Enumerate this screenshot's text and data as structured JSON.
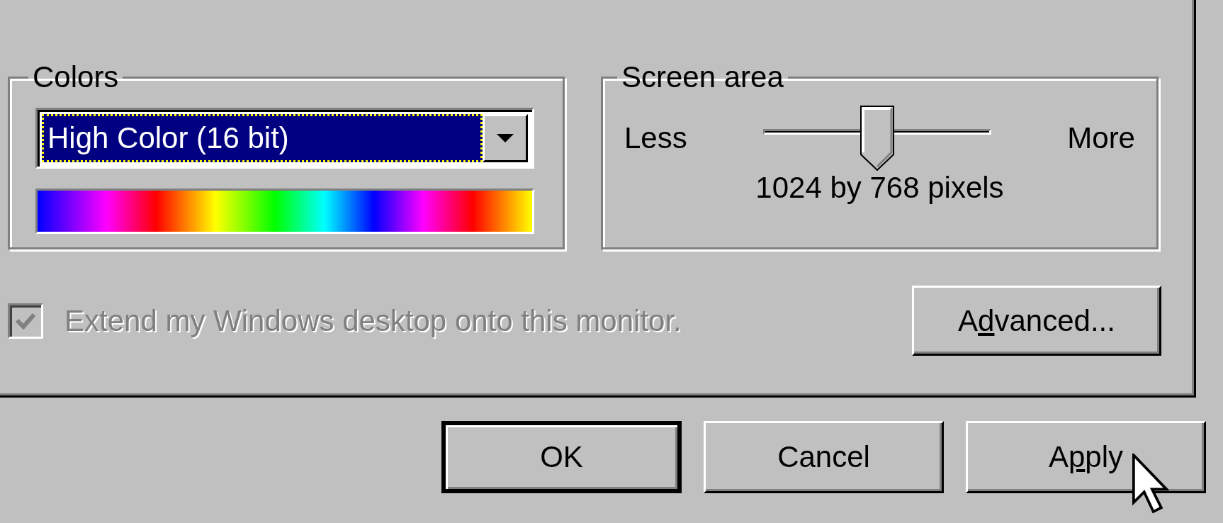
{
  "colors": {
    "label": "Colors",
    "value": "High Color (16 bit)",
    "focused": true
  },
  "screen_area": {
    "label": "Screen area",
    "min_label": "Less",
    "max_label": "More",
    "reading": "1024 by 768 pixels"
  },
  "extend_desktop": {
    "label": "Extend my Windows desktop onto this monitor.",
    "checked": true,
    "disabled": true
  },
  "advanced_button": {
    "before": "A",
    "access_key": "d",
    "after": "vanced..."
  },
  "buttons": [
    {
      "before": "OK",
      "default": true
    },
    {
      "before": "Cancel",
      "default": false
    },
    {
      "before": "A",
      "access_key": "p",
      "after": "ply",
      "default": false
    }
  ]
}
